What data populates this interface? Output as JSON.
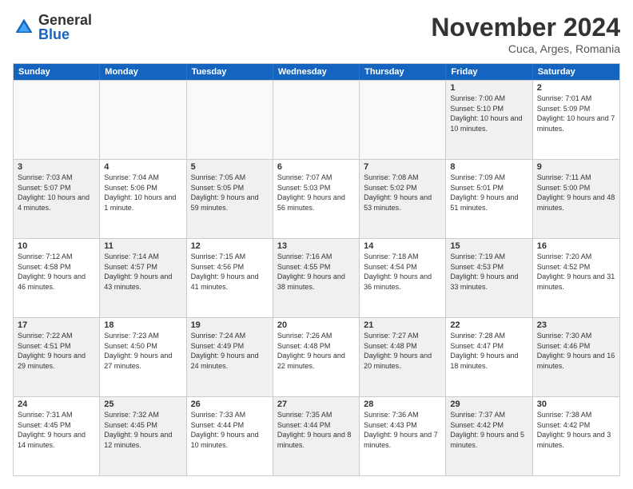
{
  "logo": {
    "general": "General",
    "blue": "Blue"
  },
  "header": {
    "month": "November 2024",
    "location": "Cuca, Arges, Romania"
  },
  "weekdays": [
    "Sunday",
    "Monday",
    "Tuesday",
    "Wednesday",
    "Thursday",
    "Friday",
    "Saturday"
  ],
  "rows": [
    [
      {
        "day": "",
        "text": "",
        "empty": true
      },
      {
        "day": "",
        "text": "",
        "empty": true
      },
      {
        "day": "",
        "text": "",
        "empty": true
      },
      {
        "day": "",
        "text": "",
        "empty": true
      },
      {
        "day": "",
        "text": "",
        "empty": true
      },
      {
        "day": "1",
        "text": "Sunrise: 7:00 AM\nSunset: 5:10 PM\nDaylight: 10 hours and 10 minutes.",
        "shade": true
      },
      {
        "day": "2",
        "text": "Sunrise: 7:01 AM\nSunset: 5:09 PM\nDaylight: 10 hours and 7 minutes.",
        "shade": false
      }
    ],
    [
      {
        "day": "3",
        "text": "Sunrise: 7:03 AM\nSunset: 5:07 PM\nDaylight: 10 hours and 4 minutes.",
        "shade": true
      },
      {
        "day": "4",
        "text": "Sunrise: 7:04 AM\nSunset: 5:06 PM\nDaylight: 10 hours and 1 minute.",
        "shade": false
      },
      {
        "day": "5",
        "text": "Sunrise: 7:05 AM\nSunset: 5:05 PM\nDaylight: 9 hours and 59 minutes.",
        "shade": true
      },
      {
        "day": "6",
        "text": "Sunrise: 7:07 AM\nSunset: 5:03 PM\nDaylight: 9 hours and 56 minutes.",
        "shade": false
      },
      {
        "day": "7",
        "text": "Sunrise: 7:08 AM\nSunset: 5:02 PM\nDaylight: 9 hours and 53 minutes.",
        "shade": true
      },
      {
        "day": "8",
        "text": "Sunrise: 7:09 AM\nSunset: 5:01 PM\nDaylight: 9 hours and 51 minutes.",
        "shade": false
      },
      {
        "day": "9",
        "text": "Sunrise: 7:11 AM\nSunset: 5:00 PM\nDaylight: 9 hours and 48 minutes.",
        "shade": true
      }
    ],
    [
      {
        "day": "10",
        "text": "Sunrise: 7:12 AM\nSunset: 4:58 PM\nDaylight: 9 hours and 46 minutes.",
        "shade": false
      },
      {
        "day": "11",
        "text": "Sunrise: 7:14 AM\nSunset: 4:57 PM\nDaylight: 9 hours and 43 minutes.",
        "shade": true
      },
      {
        "day": "12",
        "text": "Sunrise: 7:15 AM\nSunset: 4:56 PM\nDaylight: 9 hours and 41 minutes.",
        "shade": false
      },
      {
        "day": "13",
        "text": "Sunrise: 7:16 AM\nSunset: 4:55 PM\nDaylight: 9 hours and 38 minutes.",
        "shade": true
      },
      {
        "day": "14",
        "text": "Sunrise: 7:18 AM\nSunset: 4:54 PM\nDaylight: 9 hours and 36 minutes.",
        "shade": false
      },
      {
        "day": "15",
        "text": "Sunrise: 7:19 AM\nSunset: 4:53 PM\nDaylight: 9 hours and 33 minutes.",
        "shade": true
      },
      {
        "day": "16",
        "text": "Sunrise: 7:20 AM\nSunset: 4:52 PM\nDaylight: 9 hours and 31 minutes.",
        "shade": false
      }
    ],
    [
      {
        "day": "17",
        "text": "Sunrise: 7:22 AM\nSunset: 4:51 PM\nDaylight: 9 hours and 29 minutes.",
        "shade": true
      },
      {
        "day": "18",
        "text": "Sunrise: 7:23 AM\nSunset: 4:50 PM\nDaylight: 9 hours and 27 minutes.",
        "shade": false
      },
      {
        "day": "19",
        "text": "Sunrise: 7:24 AM\nSunset: 4:49 PM\nDaylight: 9 hours and 24 minutes.",
        "shade": true
      },
      {
        "day": "20",
        "text": "Sunrise: 7:26 AM\nSunset: 4:48 PM\nDaylight: 9 hours and 22 minutes.",
        "shade": false
      },
      {
        "day": "21",
        "text": "Sunrise: 7:27 AM\nSunset: 4:48 PM\nDaylight: 9 hours and 20 minutes.",
        "shade": true
      },
      {
        "day": "22",
        "text": "Sunrise: 7:28 AM\nSunset: 4:47 PM\nDaylight: 9 hours and 18 minutes.",
        "shade": false
      },
      {
        "day": "23",
        "text": "Sunrise: 7:30 AM\nSunset: 4:46 PM\nDaylight: 9 hours and 16 minutes.",
        "shade": true
      }
    ],
    [
      {
        "day": "24",
        "text": "Sunrise: 7:31 AM\nSunset: 4:45 PM\nDaylight: 9 hours and 14 minutes.",
        "shade": false
      },
      {
        "day": "25",
        "text": "Sunrise: 7:32 AM\nSunset: 4:45 PM\nDaylight: 9 hours and 12 minutes.",
        "shade": true
      },
      {
        "day": "26",
        "text": "Sunrise: 7:33 AM\nSunset: 4:44 PM\nDaylight: 9 hours and 10 minutes.",
        "shade": false
      },
      {
        "day": "27",
        "text": "Sunrise: 7:35 AM\nSunset: 4:44 PM\nDaylight: 9 hours and 8 minutes.",
        "shade": true
      },
      {
        "day": "28",
        "text": "Sunrise: 7:36 AM\nSunset: 4:43 PM\nDaylight: 9 hours and 7 minutes.",
        "shade": false
      },
      {
        "day": "29",
        "text": "Sunrise: 7:37 AM\nSunset: 4:42 PM\nDaylight: 9 hours and 5 minutes.",
        "shade": true
      },
      {
        "day": "30",
        "text": "Sunrise: 7:38 AM\nSunset: 4:42 PM\nDaylight: 9 hours and 3 minutes.",
        "shade": false
      }
    ]
  ]
}
